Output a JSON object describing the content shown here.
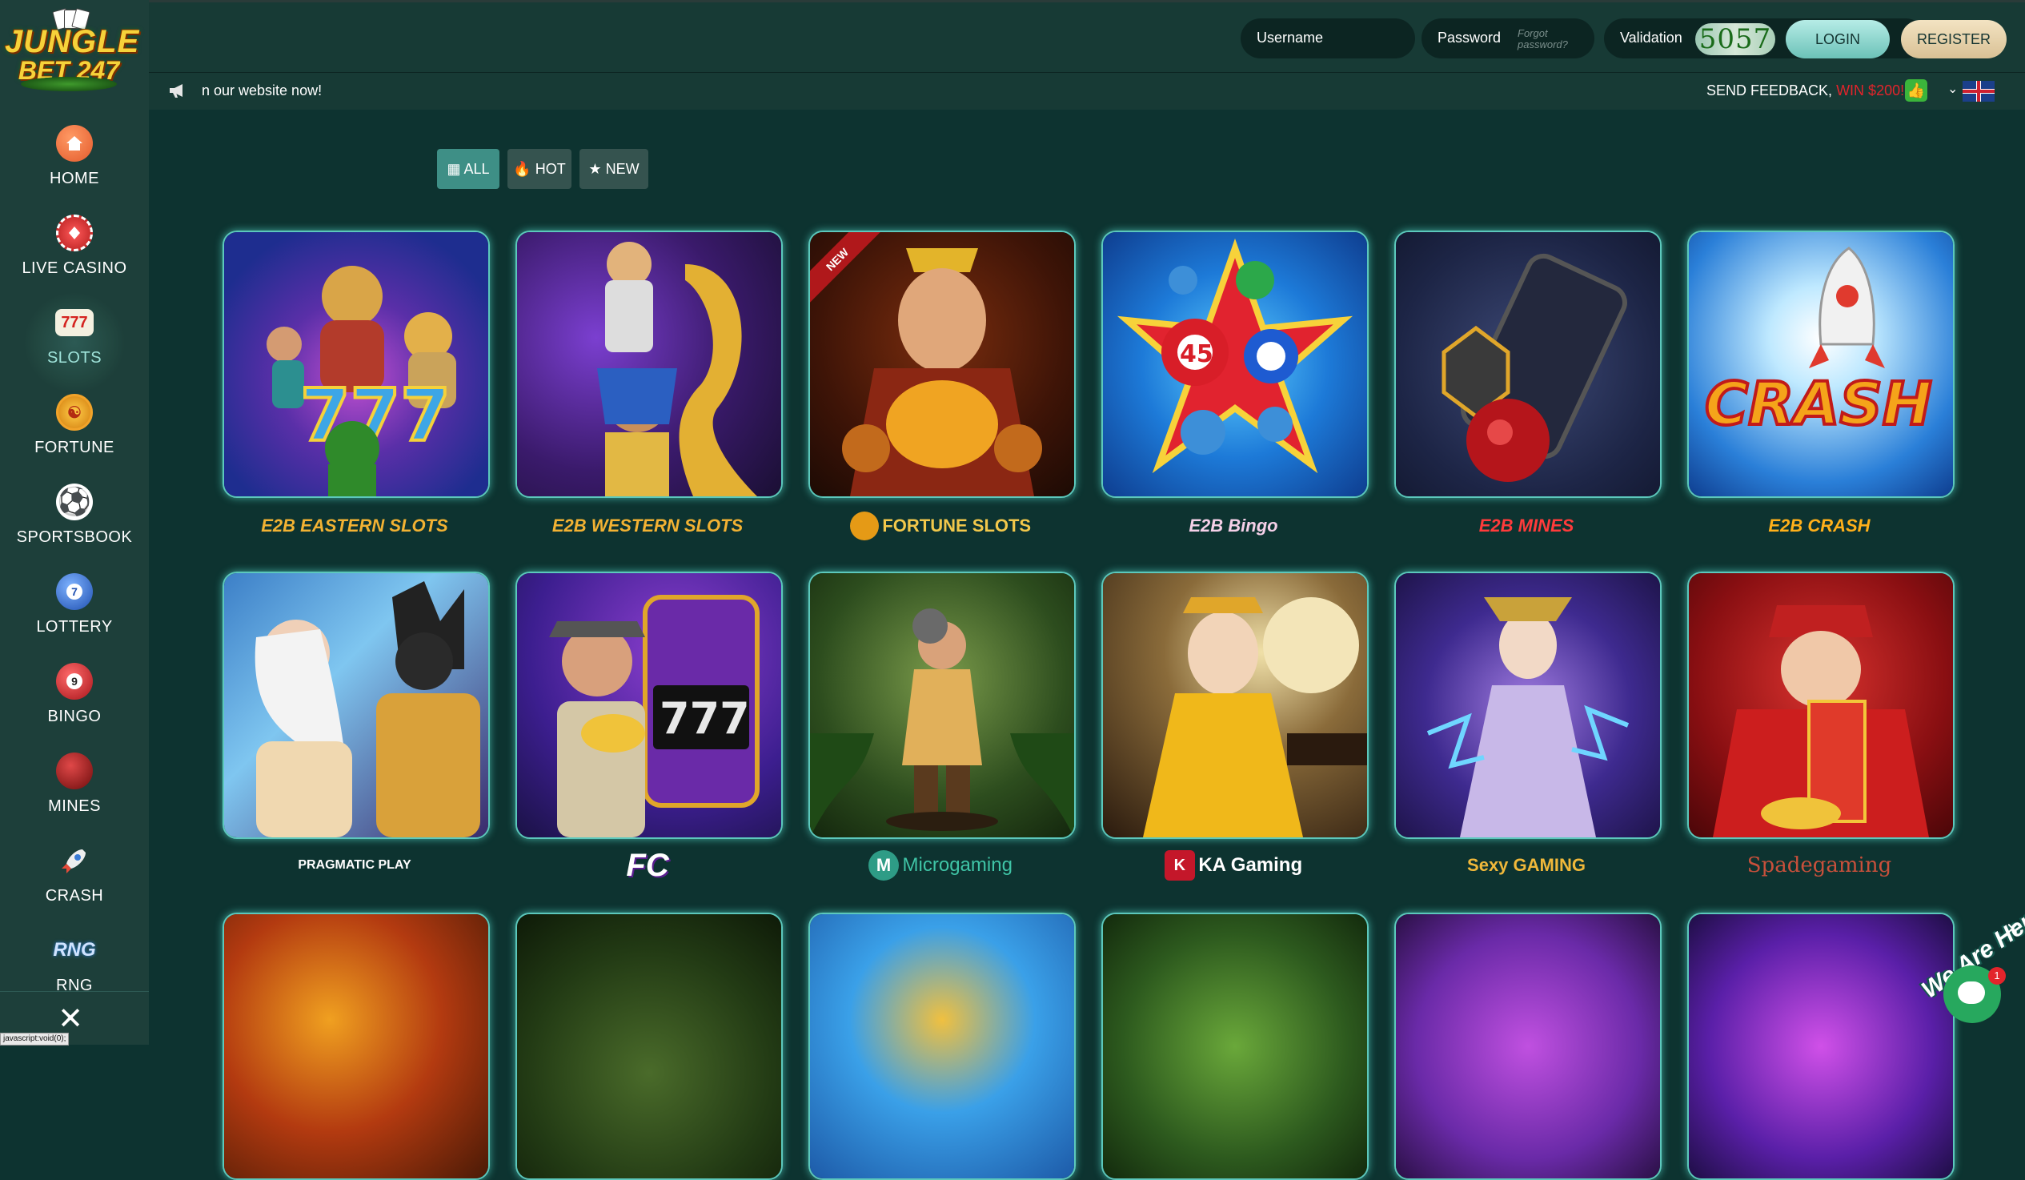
{
  "sidebar": {
    "logo": {
      "line1": "JUNGLE",
      "line2": "BET 247"
    },
    "items": [
      {
        "label": "HOME",
        "icon": "house-icon",
        "color": "#e8643a"
      },
      {
        "label": "LIVE CASINO",
        "icon": "casino-chip-icon",
        "color": "#d92b2b"
      },
      {
        "label": "SLOTS",
        "icon": "777-slot-icon",
        "color": "#ffffff"
      },
      {
        "label": "FORTUNE",
        "icon": "fortune-coin-icon",
        "color": "#e59a16"
      },
      {
        "label": "SPORTSBOOK",
        "icon": "soccer-ball-icon",
        "color": "#ffffff"
      },
      {
        "label": "LOTTERY",
        "icon": "lottery-ball-icon",
        "color": "#3570c8"
      },
      {
        "label": "BINGO",
        "icon": "bingo-ball-icon",
        "color": "#c8282d"
      },
      {
        "label": "MINES",
        "icon": "mine-bomb-icon",
        "color": "#a82020"
      },
      {
        "label": "CRASH",
        "icon": "rocket-icon",
        "color": "#d94a3a"
      },
      {
        "label": "RNG",
        "icon": "rng-icon",
        "color": "#2f7fd8"
      }
    ],
    "close_icon": "close-icon",
    "status_url": "javascript:void(0);"
  },
  "header": {
    "username_placeholder": "Username",
    "password_placeholder": "Password",
    "forgot_line1": "Forgot",
    "forgot_line2": "password?",
    "validation_label": "Validation",
    "captcha": "5057",
    "login": "LOGIN",
    "register": "REGISTER"
  },
  "subbar": {
    "marquee": "n our website now!",
    "feedback": "SEND FEEDBACK,",
    "win": "WIN $200!",
    "language": "English (UK flag)"
  },
  "filters": [
    {
      "label": "ALL",
      "icon": "grid-icon",
      "active": true
    },
    {
      "label": "HOT",
      "icon": "fire-icon",
      "active": false
    },
    {
      "label": "NEW",
      "icon": "star-icon",
      "active": false
    }
  ],
  "games_row1": [
    {
      "provider": "E2B EASTERN SLOTS",
      "color": "#f2b233"
    },
    {
      "provider": "E2B WESTERN SLOTS",
      "color": "#f2b233"
    },
    {
      "provider": "FORTUNE SLOTS",
      "color": "#f2c84b",
      "badge": "NEW"
    },
    {
      "provider": "E2B Bingo",
      "color": "#f5d0e8"
    },
    {
      "provider": "E2B MINES",
      "color": "#ff3b3b"
    },
    {
      "provider": "E2B CRASH",
      "color": "#ffb01a"
    }
  ],
  "games_row2": [
    {
      "provider": "PRAGMATIC PLAY",
      "color": "#ffffff"
    },
    {
      "provider": "FC",
      "color": "#ffffff"
    },
    {
      "provider": "Microgaming",
      "color": "#3fc4a6"
    },
    {
      "provider": "KA Gaming",
      "color": "#ffffff"
    },
    {
      "provider": "Sexy GAMING",
      "color": "#f0b83a"
    },
    {
      "provider": "Spadegaming",
      "color": "#c8503b"
    }
  ],
  "chat": {
    "title": "We Are Here!",
    "unread": "1"
  }
}
